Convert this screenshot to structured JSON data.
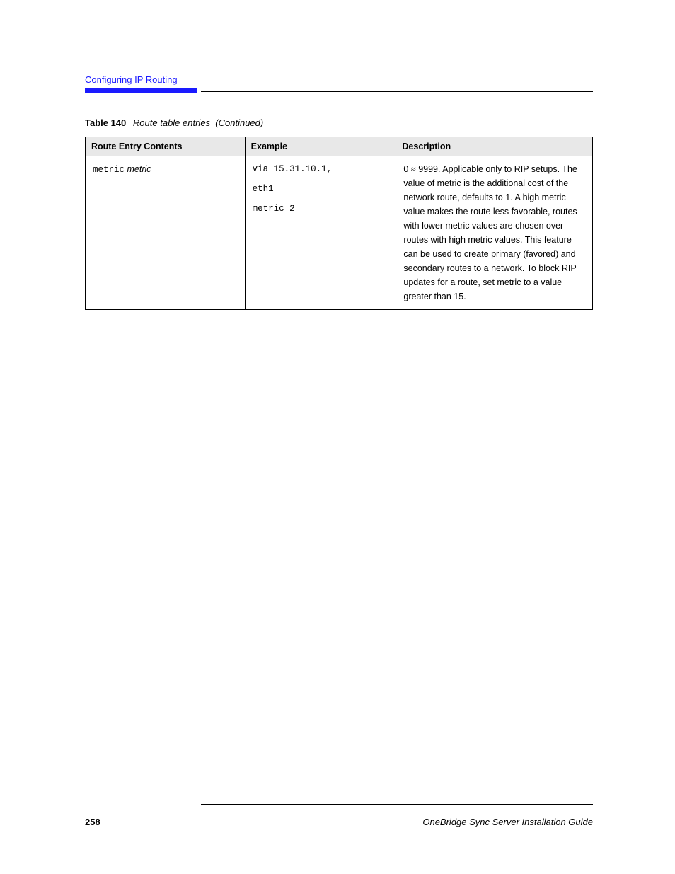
{
  "header": {
    "breadcrumb": "Configuring IP Routing"
  },
  "caption": {
    "label": "Table 140",
    "title": "Route table entries",
    "cont": "(Continued)"
  },
  "table": {
    "headers": [
      "Route Entry Contents",
      "Example",
      "Description"
    ],
    "row": {
      "col1": {
        "code": "metric"
      },
      "col2": {
        "lines": [
          "via 15.31.10.1,",
          "eth1",
          "metric 2"
        ]
      },
      "col3": {
        "text_before_approx": "0 ",
        "approx": "≈",
        "text_after_approx": " 9999. Applicable only to RIP setups. The value of metric is the additional cost of the network route, defaults to 1. A high metric value makes the route less favorable, routes with lower metric values are chosen over routes with high metric values. This feature can be used to create primary (favored) and secondary routes to a network. To block RIP updates for a route, set metric to a value greater than 15."
      }
    }
  },
  "footer": {
    "page": "258",
    "title": "OneBridge Sync Server Installation Guide"
  }
}
